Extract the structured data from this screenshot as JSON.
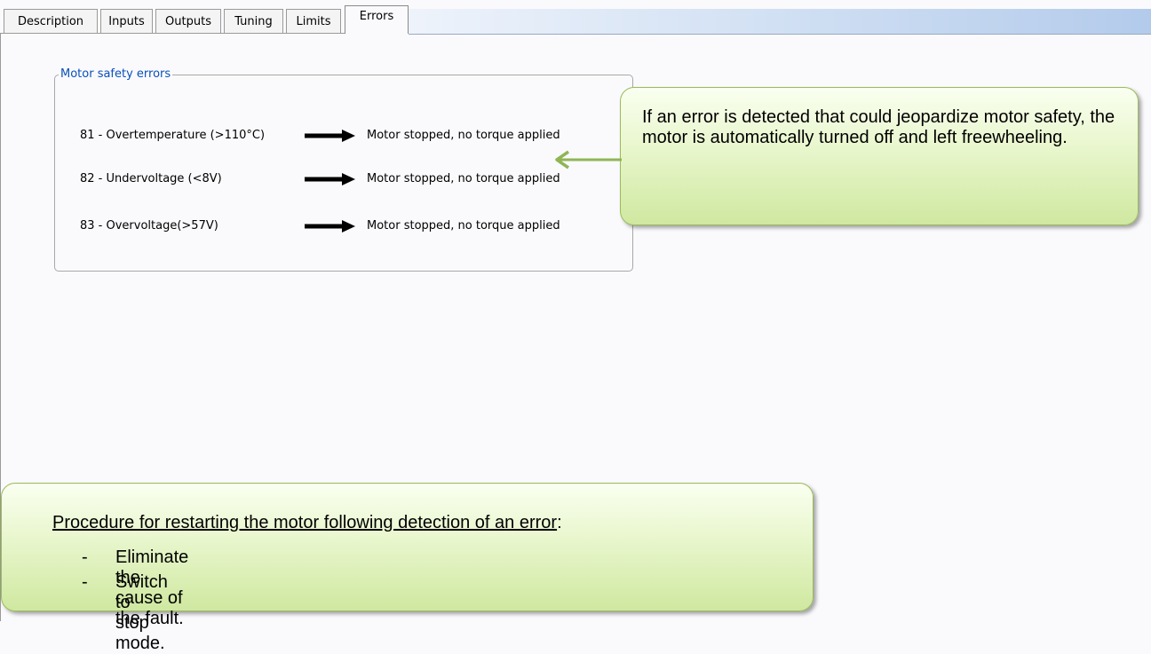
{
  "tabs": [
    {
      "label": "Description",
      "active": false
    },
    {
      "label": "Inputs",
      "active": false
    },
    {
      "label": "Outputs",
      "active": false
    },
    {
      "label": "Tuning",
      "active": false
    },
    {
      "label": "Limits",
      "active": false
    },
    {
      "label": "Errors",
      "active": true
    }
  ],
  "group": {
    "title": "Motor safety errors",
    "errors": [
      {
        "label": "81 - Overtemperature (>110°C)",
        "result": "Motor stopped, no torque applied"
      },
      {
        "label": "82 - Undervoltage (<8V)",
        "result": "Motor stopped, no torque applied"
      },
      {
        "label": "83 - Overvoltage(>57V)",
        "result": "Motor stopped, no torque applied"
      }
    ]
  },
  "callout_top": {
    "text": "If an error is detected that could jeopardize motor safety, the motor is automatically turned off and left freewheeling."
  },
  "callout_bottom": {
    "heading": "Procedure for restarting the motor following detection of an error",
    "heading_suffix": ":",
    "steps": [
      {
        "bullet": "-",
        "text": "Eliminate the cause of the fault."
      },
      {
        "bullet": "-",
        "text": "Switch to stop mode."
      }
    ]
  },
  "colors": {
    "group_title": "#0a50b8",
    "callout_border": "#9bbb59",
    "pointer_arrow": "#8fb555"
  },
  "icons": {
    "error_arrow": "right-arrow-icon",
    "callout_pointer": "left-arrow-icon"
  }
}
